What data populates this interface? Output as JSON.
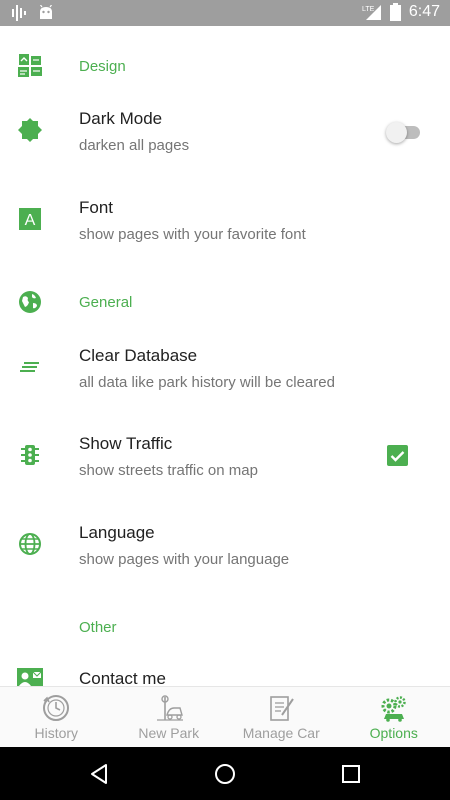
{
  "status_bar": {
    "time": "6:47",
    "network": "LTE"
  },
  "sections": [
    {
      "title": "Design"
    },
    {
      "title": "General"
    },
    {
      "title": "Other"
    }
  ],
  "items": {
    "dark_mode": {
      "title": "Dark Mode",
      "subtitle": "darken all pages",
      "enabled": false
    },
    "font": {
      "title": "Font",
      "subtitle": "show pages with your favorite font",
      "icon_letter": "A"
    },
    "clear_database": {
      "title": "Clear Database",
      "subtitle": "all data like park history will be cleared"
    },
    "show_traffic": {
      "title": "Show Traffic",
      "subtitle": "show streets traffic on map",
      "checked": true
    },
    "language": {
      "title": "Language",
      "subtitle": "show pages with your language"
    },
    "contact": {
      "title": "Contact me"
    }
  },
  "bottom_nav": [
    {
      "label": "History",
      "icon": "history-icon",
      "active": false
    },
    {
      "label": "New Park",
      "icon": "parking-icon",
      "active": false
    },
    {
      "label": "Manage Car",
      "icon": "manage-car-icon",
      "active": false
    },
    {
      "label": "Options",
      "icon": "gears-icon",
      "active": true
    }
  ],
  "colors": {
    "accent": "#4caf50",
    "status_bar": "#9e9e9e",
    "text": "#212121",
    "subtext": "#757575"
  }
}
